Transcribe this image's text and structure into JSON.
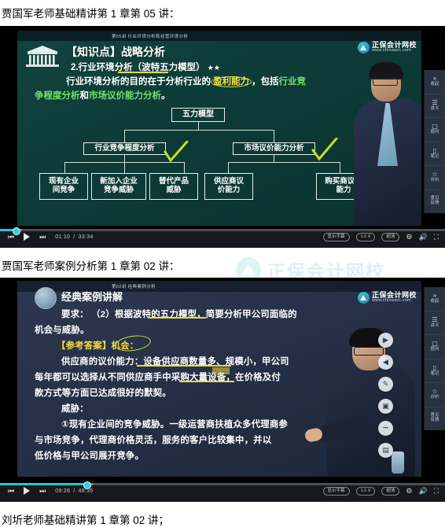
{
  "captions": {
    "line1": "贾国军老师基础精讲第 1 章第 05 讲：",
    "line2": "贾国军老师案例分析第 1 章第 02 讲：",
    "line3": "刘圻老师基础精讲第 1 章第 02 讲；"
  },
  "watermark": {
    "text": "正保会计网校"
  },
  "brand": {
    "name": "正保会计网校",
    "url": "www.chinaacc.com"
  },
  "video1": {
    "topbar_title": "第05讲  行业环境分析和经营环境分析",
    "slide": {
      "title": "【知识点】战略分析",
      "line2": "2.行业环境分析（波特五力模型）",
      "stars": "★★",
      "line3_a": "行业环境分析的目的在于分析行业的",
      "line3_b": "盈利能力",
      "line3_c": "，包括",
      "line3_d": "行业竞",
      "line4_a": "争程度分析",
      "line4_b": "和",
      "line4_c": "市场议价能力分析",
      "line4_d": "。",
      "root_box": "五力模型",
      "branch_left": "行业竞争程度分析",
      "branch_right": "市场议价能力分析",
      "leaves": [
        "现有企业\n间竞争",
        "新加入企业\n竞争威胁",
        "替代产品\n威胁",
        "供应商议\n价能力",
        "购买商议价\n能力"
      ]
    },
    "controls": {
      "prev_icon": "prev-icon",
      "play_icon": "play-icon",
      "next_icon": "next-icon",
      "current_time": "01:10",
      "separator": "/",
      "duration": "33:34",
      "subtitle_btn": "显示字幕",
      "speed_btn": "1.0 X",
      "quality_btn": "超清",
      "settings_icon": "gear-icon",
      "volume_icon": "volume-icon",
      "fullscreen_icon": "fullscreen-icon",
      "progress_percent": 3.5,
      "buffer_percent": 5
    },
    "rail": [
      {
        "icon": "»",
        "label": "收起"
      },
      {
        "icon": "☰",
        "label": "讲义"
      },
      {
        "icon": "▢",
        "label": "提问"
      },
      {
        "icon": "▯",
        "label": "笔记"
      },
      {
        "icon": "☆",
        "label": "评价"
      },
      {
        "icon": "",
        "label": "意见\n反馈"
      }
    ]
  },
  "video2": {
    "topbar_title": "第02讲  经典案例分析",
    "slide": {
      "title": "经典案例讲解",
      "lines": [
        "要求： （2）根据波特的五力模型，简要分析甲公司面临的",
        "机会与威胁。",
        "【参考答案】机会：",
        "供应商的议价能力：设备供应商数量多、规模小，甲公司",
        "每年都可以选择从不同供应商手中采购大量设备，在价格及付",
        "款方式等方面已达成很好的默契。",
        "威胁：",
        "①现有企业间的竞争威胁。一级运营商扶植众多代理商参",
        "与市场竞争，代理商价格灵活，服务的客户比较集中，并以",
        "低价格与甲公司展开竞争。"
      ]
    },
    "tools": [
      {
        "name": "play-tool",
        "glyph": "▶"
      },
      {
        "name": "back-tool",
        "glyph": "◀"
      },
      {
        "name": "pen-tool",
        "glyph": "✎"
      },
      {
        "name": "screen-tool",
        "glyph": "▣"
      },
      {
        "name": "more-tool",
        "glyph": "•••"
      },
      {
        "name": "capture-tool",
        "glyph": "▤"
      }
    ],
    "controls": {
      "prev_icon": "prev-icon",
      "play_icon": "play-icon",
      "next_icon": "next-icon",
      "current_time": "09:28",
      "separator": "/",
      "duration": "48:35",
      "subtitle_btn": "显示字幕",
      "speed_btn": "1.0 X",
      "quality_btn": "超清",
      "settings_icon": "gear-icon",
      "volume_icon": "volume-icon",
      "fullscreen_icon": "fullscreen-icon",
      "progress_percent": 19.5,
      "buffer_percent": 21
    },
    "rail": [
      {
        "icon": "»",
        "label": "收起"
      },
      {
        "icon": "☰",
        "label": "讲义"
      },
      {
        "icon": "▢",
        "label": "提问"
      },
      {
        "icon": "▯",
        "label": "笔记"
      },
      {
        "icon": "☆",
        "label": "评价"
      },
      {
        "icon": "",
        "label": "意见\n反馈"
      }
    ]
  },
  "colors": {
    "accent": "#1ec8d8",
    "slide1_bg": "#0d3b37",
    "slide2_bg": "#252f45",
    "highlight_green": "#74e36a",
    "highlight_yellow": "#f4e04a",
    "mark_green": "#c8e038"
  }
}
